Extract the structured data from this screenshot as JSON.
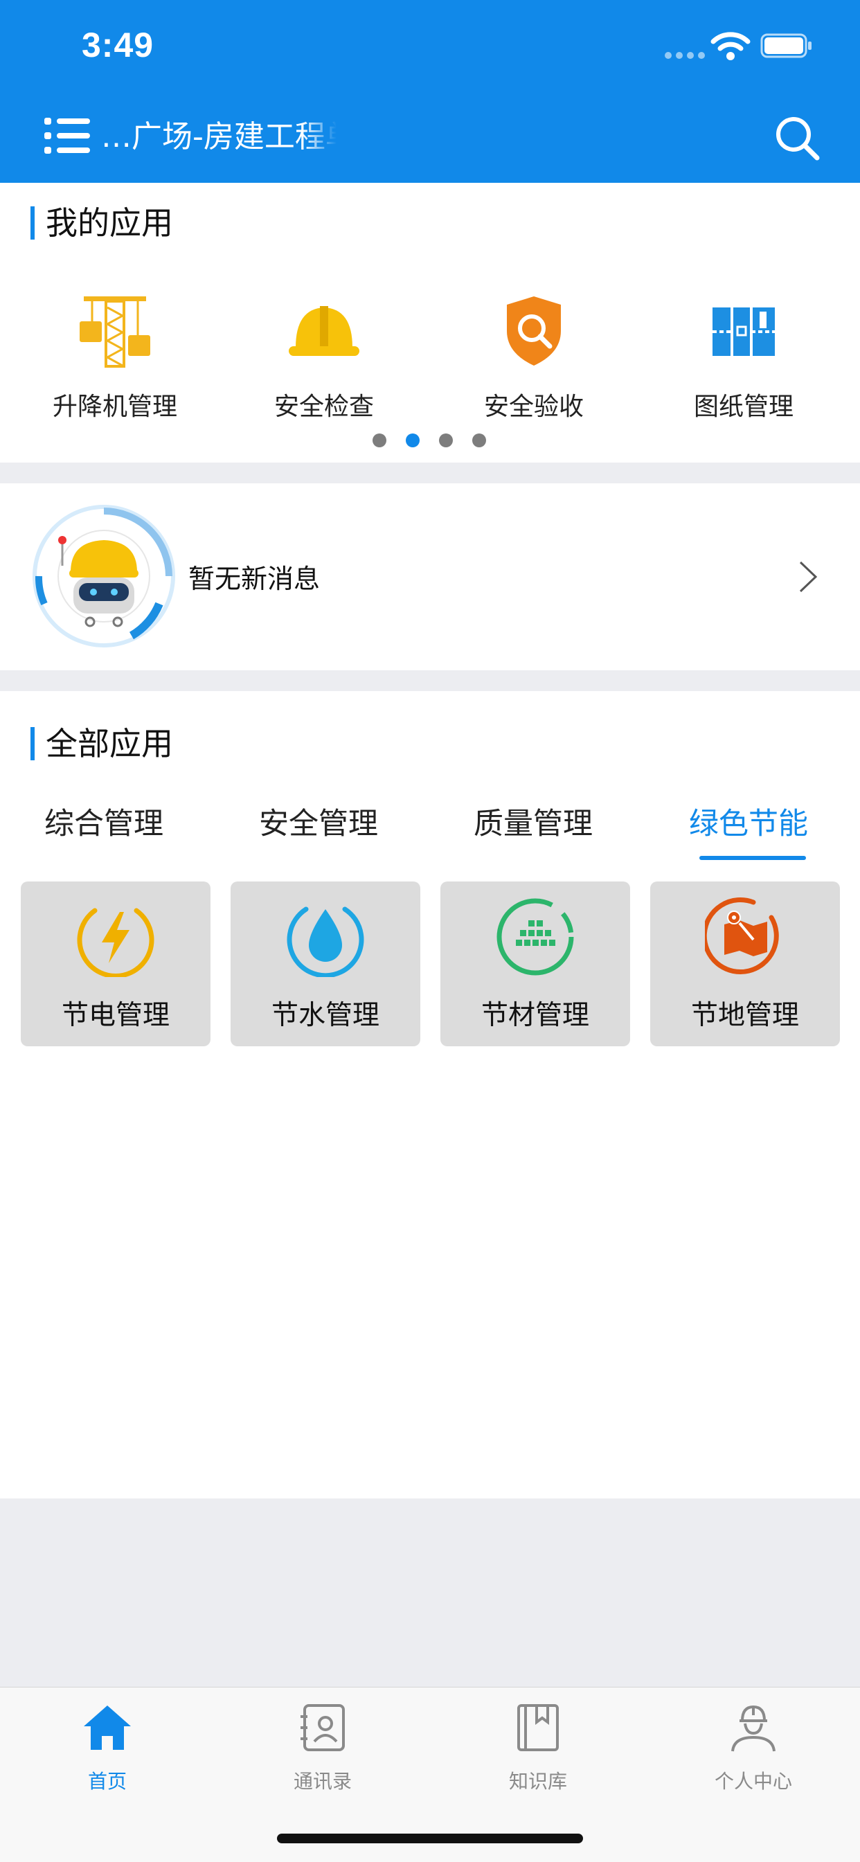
{
  "status_bar": {
    "time": "3:49"
  },
  "header": {
    "project_title": "…广场-房建工程单"
  },
  "my_apps": {
    "title": "我的应用",
    "items": [
      {
        "label": "升降机管理",
        "icon": "hoist-icon"
      },
      {
        "label": "安全检查",
        "icon": "hard-hat-icon"
      },
      {
        "label": "安全验收",
        "icon": "shield-search-icon"
      },
      {
        "label": "图纸管理",
        "icon": "blueprint-icon"
      }
    ],
    "pager": {
      "pages": 4,
      "active_index": 1
    }
  },
  "messages": {
    "text": "暂无新消息",
    "icon": "robot-assistant-icon"
  },
  "all_apps": {
    "title": "全部应用",
    "tabs": [
      {
        "label": "综合管理",
        "active": false
      },
      {
        "label": "安全管理",
        "active": false
      },
      {
        "label": "质量管理",
        "active": false
      },
      {
        "label": "绿色节能",
        "active": true
      }
    ],
    "cards": [
      {
        "label": "节电管理",
        "icon": "lightning-icon",
        "color": "#f0b000"
      },
      {
        "label": "节水管理",
        "icon": "water-drop-icon",
        "color": "#1ea6e3"
      },
      {
        "label": "节材管理",
        "icon": "bricks-icon",
        "color": "#2cb56b"
      },
      {
        "label": "节地管理",
        "icon": "land-map-icon",
        "color": "#e0540f"
      }
    ]
  },
  "tabbar": {
    "items": [
      {
        "label": "首页",
        "icon": "home-icon",
        "active": true
      },
      {
        "label": "通讯录",
        "icon": "contacts-icon",
        "active": false
      },
      {
        "label": "知识库",
        "icon": "book-icon",
        "active": false
      },
      {
        "label": "个人中心",
        "icon": "worker-profile-icon",
        "active": false
      }
    ]
  },
  "colors": {
    "primary": "#1189e9",
    "background": "#ecedf1",
    "card": "#dcdcdc",
    "inactive": "#8a8a8a"
  }
}
